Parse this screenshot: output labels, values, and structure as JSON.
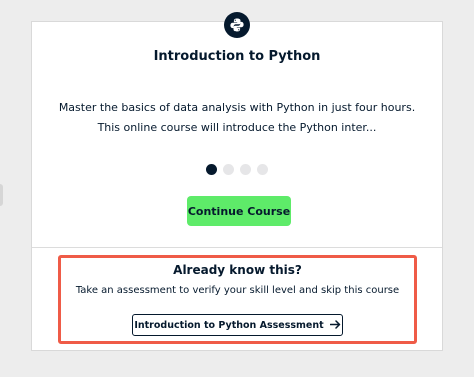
{
  "course": {
    "logo_icon": "python-logo-icon",
    "title": "Introduction to Python",
    "description_line1": "Master the basics of data analysis with Python in just four hours.",
    "description_line2": "This online course will introduce the Python inter...",
    "carousel": {
      "total": 4,
      "active_index": 0
    },
    "continue_label": "Continue Course",
    "continue_color": "#5eeb69"
  },
  "assessment": {
    "heading": "Already know this?",
    "description": "Take an assessment to verify your skill level and skip this course",
    "button_label": "Introduction to Python Assessment",
    "button_icon": "arrow-right-icon",
    "highlight_color": "#ef5b47"
  }
}
